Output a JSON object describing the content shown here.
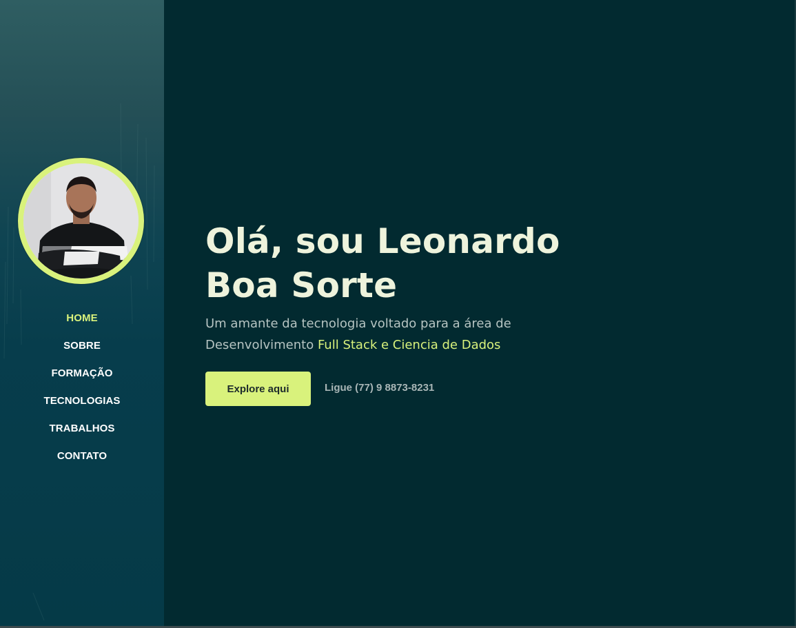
{
  "sidebar": {
    "avatar_alt": "Leonardo Boa Sorte",
    "nav": [
      {
        "label": "HOME",
        "active": true
      },
      {
        "label": "SOBRE",
        "active": false
      },
      {
        "label": "FORMAÇÃO",
        "active": false
      },
      {
        "label": "TECNOLOGIAS",
        "active": false
      },
      {
        "label": "TRABALHOS",
        "active": false
      },
      {
        "label": "CONTATO",
        "active": false
      }
    ]
  },
  "hero": {
    "title_line1": "Olá, sou Leonardo",
    "title_line2": "Boa Sorte",
    "lead_text": "Um amante da tecnologia voltado para a área de Desenvolvimento",
    "lead_highlight": "Full Stack e Ciencia de Dados",
    "cta_label": "Explore aqui",
    "phone_text": "Ligue (77) 9 8873-8231"
  },
  "colors": {
    "background": "#022a30",
    "sidebar": "#073d4c",
    "accent": "#d9f27c",
    "title": "#eef3dc",
    "body_text": "#b6c4c2"
  }
}
